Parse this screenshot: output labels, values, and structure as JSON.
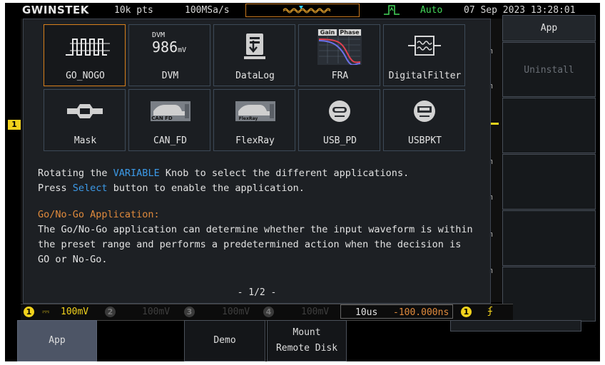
{
  "status_bar": {
    "brand": "GWINSTEK",
    "record_length": "10k pts",
    "sample_rate": "100MSa/s",
    "trigger_mode": "Auto",
    "datetime": "07 Sep 2023 13:28:01"
  },
  "apps": [
    {
      "label": "GO_NOGO",
      "icon": "go-nogo-icon",
      "selected": true
    },
    {
      "label": "DVM",
      "icon": "dvm-icon",
      "dvm_text": "DVM",
      "dvm_value": "986",
      "dvm_unit": "mV"
    },
    {
      "label": "DataLog",
      "icon": "datalog-icon"
    },
    {
      "label": "FRA",
      "icon": "fra-icon",
      "gain": "Gain",
      "phase": "Phase"
    },
    {
      "label": "DigitalFilter",
      "icon": "digital-filter-icon"
    },
    {
      "label": "Mask",
      "icon": "mask-icon"
    },
    {
      "label": "CAN_FD",
      "icon": "can-fd-icon",
      "badge": "CAN FD"
    },
    {
      "label": "FlexRay",
      "icon": "flexray-icon",
      "badge": "FlexRay"
    },
    {
      "label": "USB_PD",
      "icon": "usb-pd-icon"
    },
    {
      "label": "USBPKT",
      "icon": "usbpkt-icon"
    }
  ],
  "instructions": {
    "line1_pre": "Rotating the ",
    "line1_key": "VARIABLE",
    "line1_post": " Knob to select the different applications.",
    "line2_pre": "Press ",
    "line2_key": "Select",
    "line2_post": " button to enable the application."
  },
  "app_description": {
    "title": "Go/No-Go Application:",
    "line1": "The Go/No-Go application can determine whether the input waveform is within",
    "line2": "the preset range and performs a predetermined action when the decision is",
    "line3": "GO or No-Go."
  },
  "pagination": "- 1/2 -",
  "side_menu": {
    "title": "App",
    "uninstall": "Uninstall"
  },
  "channel_bar": {
    "ch1_num": "1",
    "ch1_scale": "100mV",
    "ch2_num": "2",
    "ch2_scale": "100mV",
    "ch3_num": "3",
    "ch3_scale": "100mV",
    "ch4_num": "4",
    "ch4_scale": "100mV",
    "timebase": "10us",
    "trigger_pos": "-100.000ns",
    "trig_src": "1"
  },
  "ch1_marker": "1",
  "unit_label": "m",
  "bottom_menu": {
    "app": "App",
    "demo": "Demo",
    "mount_line1": "Mount",
    "mount_line2": "Remote Disk"
  },
  "colors": {
    "accent_orange": "#d8801c",
    "highlight_blue": "#3c9ae8",
    "ch1_yellow": "#f2d21c",
    "auto_green": "#44d85a"
  }
}
